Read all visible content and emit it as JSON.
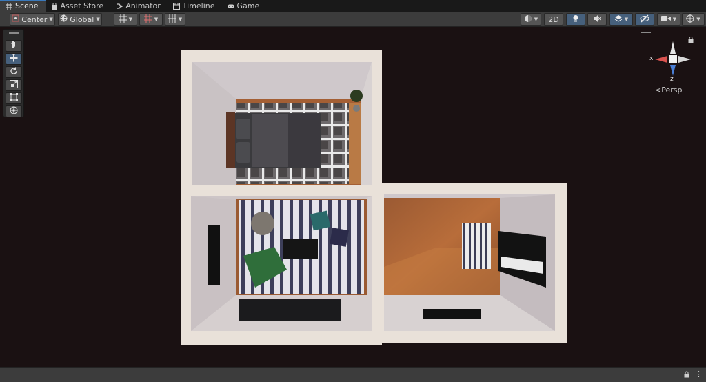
{
  "tabs": [
    {
      "label": "Scene",
      "icon": "grid-icon",
      "active": true
    },
    {
      "label": "Asset Store",
      "icon": "bag-icon",
      "active": false
    },
    {
      "label": "Animator",
      "icon": "animator-icon",
      "active": false
    },
    {
      "label": "Timeline",
      "icon": "timeline-icon",
      "active": false
    },
    {
      "label": "Game",
      "icon": "gamepad-icon",
      "active": false
    }
  ],
  "toolbar": {
    "pivot_label": "Center",
    "space_label": "Global",
    "mode_2d_label": "2D"
  },
  "gizmo": {
    "x_label": "x",
    "z_label": "z",
    "projection_label": "Persp"
  },
  "colors": {
    "accent": "#3a79bb",
    "active_button": "#46607c",
    "axis_x": "#d9534f",
    "axis_y": "#8fd14f",
    "axis_z": "#4a7fd6",
    "viewport_bg": "#1a1112"
  }
}
